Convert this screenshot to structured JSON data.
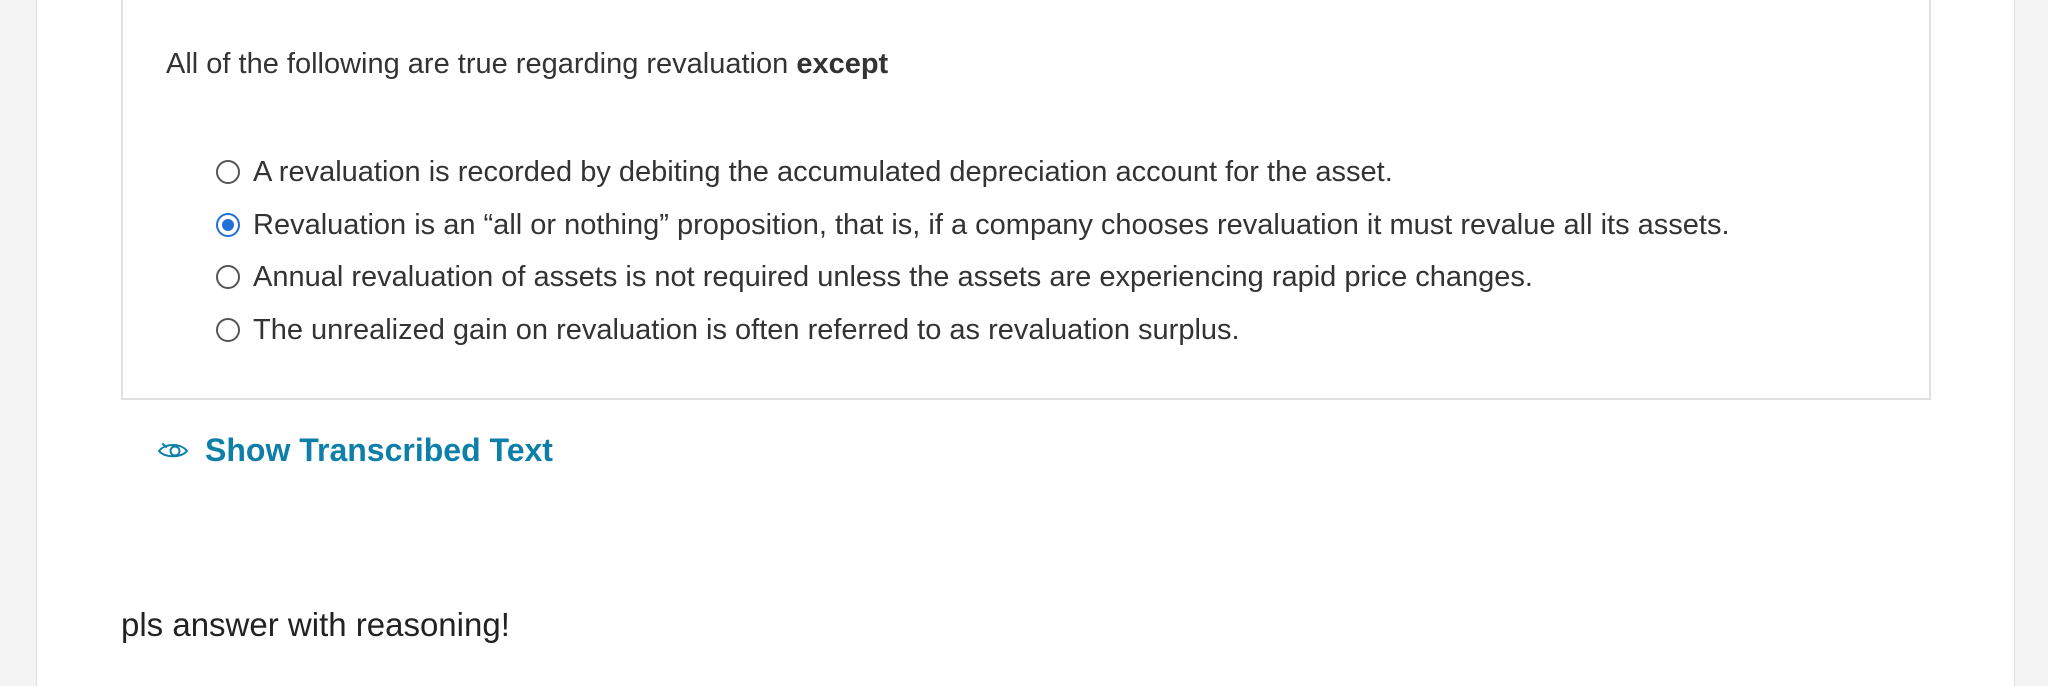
{
  "question": {
    "stem": "All of the following are true regarding revaluation",
    "stem_emphasis": "except",
    "options": [
      {
        "label": "A revaluation is recorded by debiting the accumulated depreciation account for the asset.",
        "selected": false
      },
      {
        "label": "Revaluation is an “all or nothing” proposition, that is, if a company chooses revaluation it must revalue all its assets.",
        "selected": true
      },
      {
        "label": "Annual revaluation of assets is not required unless the assets are experiencing rapid price changes.",
        "selected": false
      },
      {
        "label": "The unrealized gain on revaluation is often referred to as revaluation surplus.",
        "selected": false
      }
    ]
  },
  "transcribed_link": {
    "label": "Show Transcribed Text",
    "icon": "eye-icon"
  },
  "comment": {
    "text": "pls answer with reasoning!"
  },
  "colors": {
    "radio_selected": "#1f6fd6",
    "link": "#0e7fa8",
    "box_border": "#e0e0e0"
  }
}
